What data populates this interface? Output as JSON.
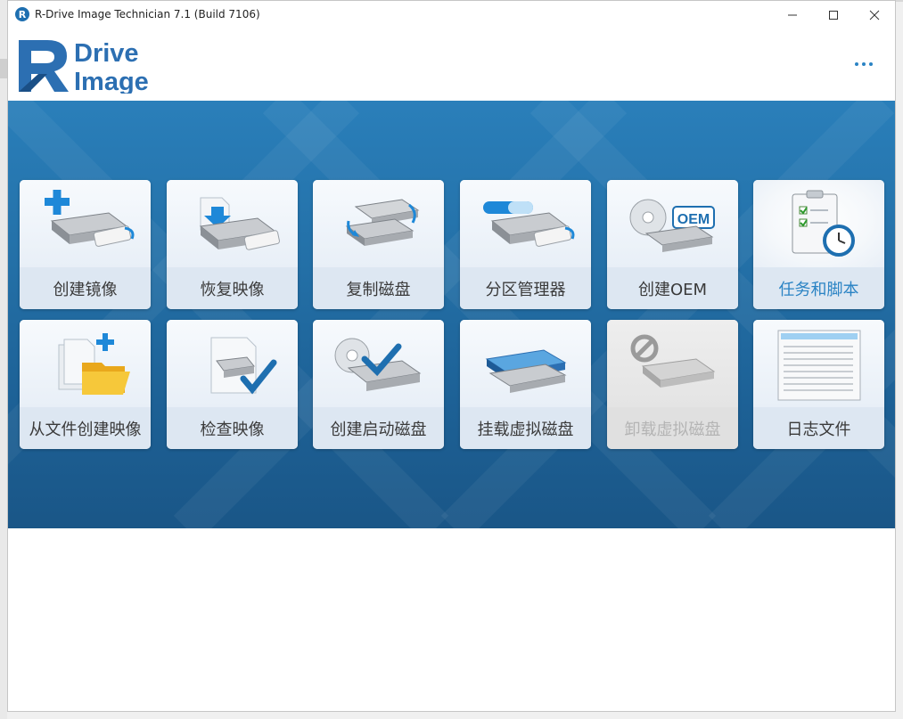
{
  "window": {
    "title": "R-Drive Image Technician 7.1 (Build 7106)",
    "app_icon_letter": "R"
  },
  "logo": {
    "line1": "Drive",
    "line2": "Image"
  },
  "colors": {
    "accent": "#2a83c4",
    "panel_top": "#2a7fba",
    "panel_bottom": "#1a5687",
    "disabled_text": "#b4b4b4"
  },
  "tiles": [
    {
      "label": "创建镜像",
      "icon": "create-image-icon",
      "state": "normal"
    },
    {
      "label": "恢复映像",
      "icon": "restore-image-icon",
      "state": "normal"
    },
    {
      "label": "复制磁盘",
      "icon": "copy-disk-icon",
      "state": "normal"
    },
    {
      "label": "分区管理器",
      "icon": "partition-manager-icon",
      "state": "normal"
    },
    {
      "label": "创建OEM",
      "icon": "create-oem-icon",
      "state": "normal"
    },
    {
      "label": "任务和脚本",
      "icon": "tasks-scripts-icon",
      "state": "active"
    },
    {
      "label": "从文件创建映像",
      "icon": "image-from-files-icon",
      "state": "normal"
    },
    {
      "label": "检查映像",
      "icon": "check-image-icon",
      "state": "normal"
    },
    {
      "label": "创建启动磁盘",
      "icon": "create-startup-disk-icon",
      "state": "normal"
    },
    {
      "label": "挂载虚拟磁盘",
      "icon": "mount-virtual-disk-icon",
      "state": "normal"
    },
    {
      "label": "卸载虚拟磁盘",
      "icon": "unmount-virtual-disk-icon",
      "state": "disabled"
    },
    {
      "label": "日志文件",
      "icon": "log-file-icon",
      "state": "normal"
    }
  ]
}
